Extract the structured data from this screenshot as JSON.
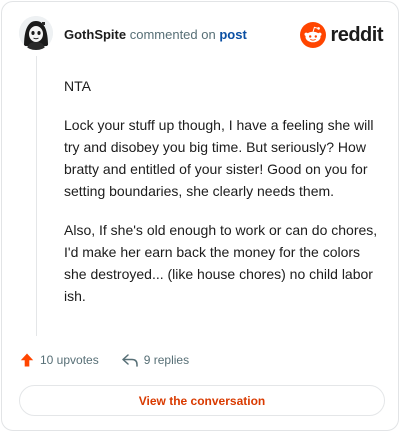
{
  "header": {
    "username": "GothSpite",
    "action_text": " commented on ",
    "link_text": "post"
  },
  "brand": {
    "name": "reddit",
    "accent_color": "#ff4500"
  },
  "comment": {
    "paragraphs": [
      "NTA",
      "Lock your stuff up though, I have a feeling she will try and disobey you big time. But seriously? How bratty and entitled of your sister! Good on you for setting boundaries, she clearly needs them.",
      "Also, If she's old enough to work or can do chores, I'd make her earn back the money for the colors she destroyed... (like house chores) no child labor ish."
    ]
  },
  "actions": {
    "upvotes_label": "10 upvotes",
    "replies_label": "9 replies",
    "upvote_icon": "arrow-up-icon",
    "reply_icon": "reply-icon"
  },
  "footer": {
    "view_label": "View the conversation"
  }
}
